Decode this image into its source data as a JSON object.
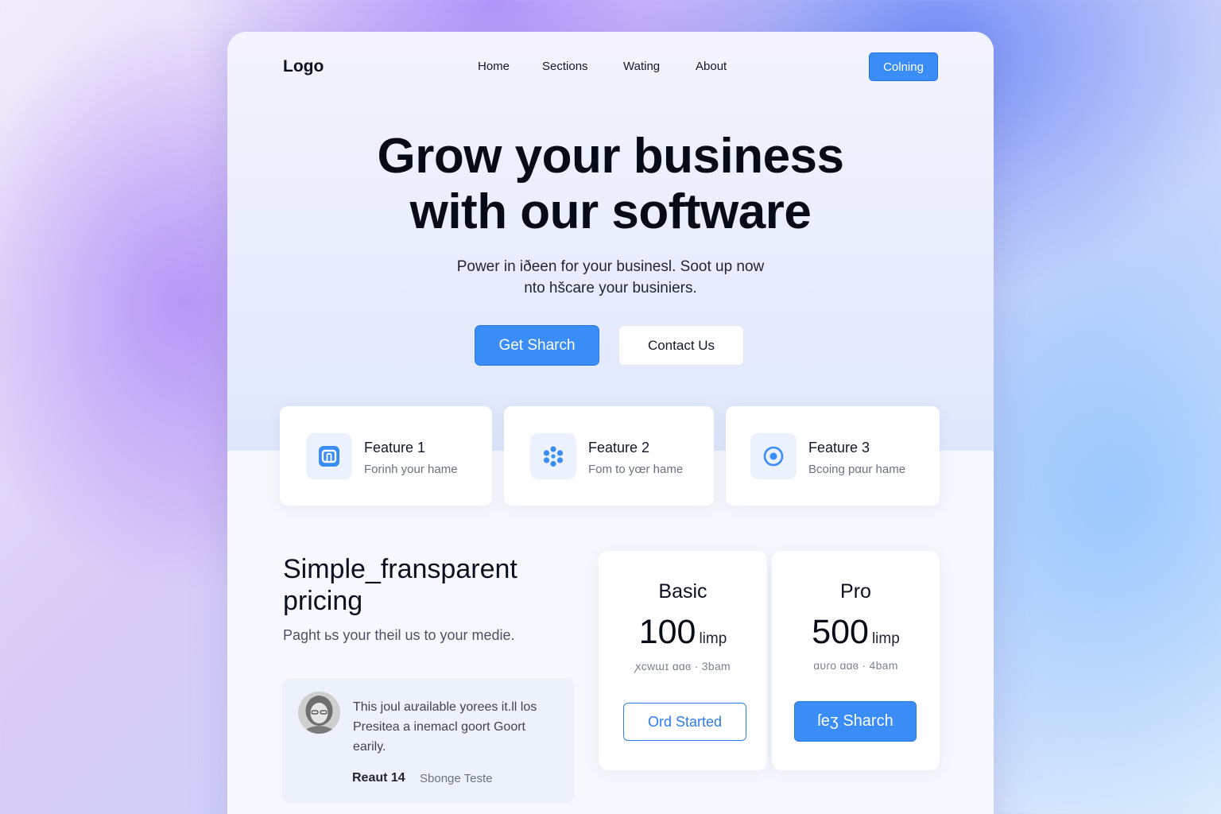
{
  "nav": {
    "logo": "Logo",
    "links": [
      "Home",
      "Sections",
      "Wating",
      "About"
    ],
    "cta": "Colning"
  },
  "hero": {
    "title_line1": "Grow your business",
    "title_line2": "with our software",
    "subtitle_line1": "Power in iðeen for your businesl. Soot up now",
    "subtitle_line2": "nto hšcare your businiers.",
    "primary_button": "Get Sharch",
    "secondary_button": "Contact Us"
  },
  "features": [
    {
      "title": "Feature 1",
      "desc": "Forinh your hame",
      "icon": "app-window-icon"
    },
    {
      "title": "Feature 2",
      "desc": "Fom to yœr hame",
      "icon": "dots-cluster-icon"
    },
    {
      "title": "Feature 3",
      "desc": "Bcoing pαur hame",
      "icon": "target-icon"
    }
  ],
  "pricing": {
    "title": "Simple_fransparent pricing",
    "subtitle": "Paght ьs your theil us to your medie.",
    "testimonial": {
      "quote": "This joul aưailable yorees it.ll los Presitea a inemacl goort Goort earily.",
      "name": "Reaut 14",
      "role": "Sbonge Teste"
    },
    "plans": [
      {
        "name": "Basic",
        "price": "100",
        "unit": "limp",
        "note": "ꭗcwɯɪ ɑɑɞ · 3bam",
        "button": "Ord Started",
        "style": "outline"
      },
      {
        "name": "Pro",
        "price": "500",
        "unit": "limp",
        "note": "ɑυɾo ɑɑɞ · 4bam",
        "button": "ſeʒ Sharch",
        "style": "solid"
      }
    ]
  },
  "colors": {
    "accent": "#3a8cf6",
    "accent_dark": "#2a78e4",
    "text_dark": "#070b18",
    "muted": "#6b7280"
  }
}
